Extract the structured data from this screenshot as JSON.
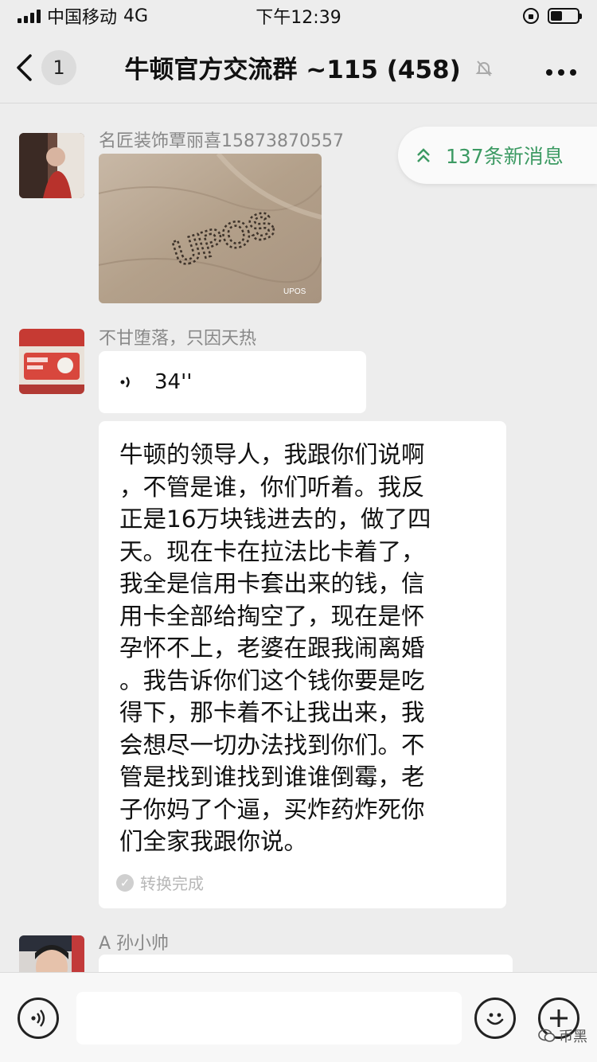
{
  "status_bar": {
    "carrier": "中国移动",
    "network": "4G",
    "time": "下午12:39"
  },
  "nav": {
    "back_icon": "chevron-left-icon",
    "unread_count": "1",
    "title": "牛顿官方交流群 ~115 (458)",
    "mute_icon": "bell-muted-icon",
    "more_icon": "more-dots-icon"
  },
  "new_messages": {
    "icon": "chevron-double-up-icon",
    "label": "137条新消息"
  },
  "messages": [
    {
      "sender": "名匠装饰覃丽喜15873870557",
      "type": "image",
      "image_text": "UPOS",
      "image_brand": "UPOS"
    },
    {
      "sender": "不甘堕落，只因天热",
      "type": "voice",
      "duration": "34''"
    },
    {
      "type": "voice-to-text",
      "text": "牛顿的领导人，我跟你们说啊\n，不管是谁，你们听着。我反\n正是16万块钱进去的，做了四\n天。现在卡在拉法比卡着了，\n我全是信用卡套出来的钱，信\n用卡全部给掏空了，现在是怀\n孕怀不上，老婆在跟我闹离婚\n。我告诉你们这个钱你要是吃\n得下，那卡着不让我出来，我\n会想尽一切办法找到你们。不\n管是找到谁找到谁谁倒霉，老\n子你妈了个逼，买炸药炸死你\n们全家我跟你说。",
      "status": "转换完成"
    },
    {
      "sender": "A 孙小帅",
      "type": "text"
    }
  ],
  "input_bar": {
    "voice_icon": "voice-input-icon",
    "emoji_icon": "emoji-icon",
    "plus_icon": "plus-icon"
  },
  "watermark": "币黑"
}
